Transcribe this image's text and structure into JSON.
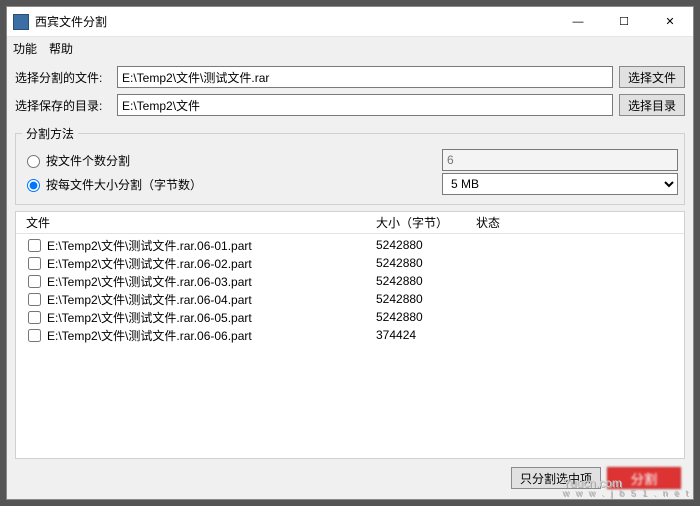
{
  "window": {
    "title": "西宾文件分割"
  },
  "title_buttons": {
    "minimize": "—",
    "maximize": "☐",
    "close": "✕"
  },
  "menu": {
    "function": "功能",
    "help": "帮助"
  },
  "labels": {
    "choose_file": "选择分割的文件:",
    "choose_dir": "选择保存的目录:",
    "browse_file": "选择文件",
    "browse_dir": "选择目录",
    "split_method_group": "分割方法",
    "by_count": "按文件个数分割",
    "by_size": "按每文件大小分割（字节数）",
    "col_file": "文件",
    "col_size": "大小（字节）",
    "col_status": "状态",
    "split_selected": "只分割选中项",
    "red_button": "分割"
  },
  "fields": {
    "file_path": "E:\\Temp2\\文件\\测试文件.rar",
    "dir_path": "E:\\Temp2\\文件",
    "count_value": "6",
    "size_value": "5 MB",
    "selected_method": "by_size"
  },
  "files": [
    {
      "name": "E:\\Temp2\\文件\\测试文件.rar.06-01.part",
      "size": "5242880",
      "status": ""
    },
    {
      "name": "E:\\Temp2\\文件\\测试文件.rar.06-02.part",
      "size": "5242880",
      "status": ""
    },
    {
      "name": "E:\\Temp2\\文件\\测试文件.rar.06-03.part",
      "size": "5242880",
      "status": ""
    },
    {
      "name": "E:\\Temp2\\文件\\测试文件.rar.06-04.part",
      "size": "5242880",
      "status": ""
    },
    {
      "name": "E:\\Temp2\\文件\\测试文件.rar.06-05.part",
      "size": "5242880",
      "status": ""
    },
    {
      "name": "E:\\Temp2\\文件\\测试文件.rar.06-06.part",
      "size": "374424",
      "status": ""
    }
  ],
  "watermark": {
    "main": "Yuucn.com",
    "sub": "w w w . j b 5 1 . n e t"
  }
}
